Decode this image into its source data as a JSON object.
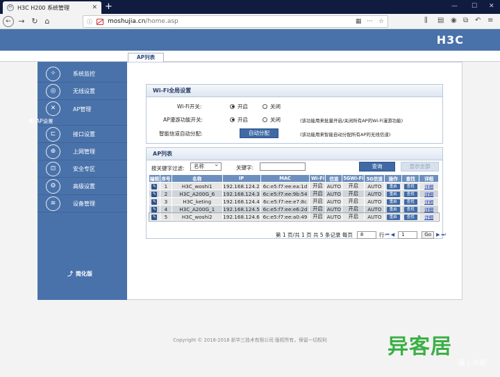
{
  "browser": {
    "tab_title": "H3C H200 系统管理",
    "tab_favicon": "Ⓜ",
    "url_host": "moshujia.cn",
    "url_path": "/home.asp"
  },
  "header": {
    "logo": "H3C"
  },
  "top_tab": "AP列表",
  "sidebar": {
    "items": [
      {
        "label": "系统监控",
        "icon": "monitor-icon",
        "glyph": "✧"
      },
      {
        "label": "无线设置",
        "icon": "wireless-icon",
        "glyph": "◎"
      },
      {
        "label": "AP管理",
        "icon": "ap-icon",
        "glyph": "✕"
      },
      {
        "label": "接口设置",
        "icon": "interface-icon",
        "glyph": "⊏"
      },
      {
        "label": "上网管理",
        "icon": "globe-icon",
        "glyph": "⊕"
      },
      {
        "label": "安全专区",
        "icon": "lock-icon",
        "glyph": "⊡"
      },
      {
        "label": "高级设置",
        "icon": "gear-icon",
        "glyph": "⚙"
      },
      {
        "label": "设备管理",
        "icon": "device-icon",
        "glyph": "≋"
      }
    ],
    "sub_item": "AP设置",
    "simplify": "简化版"
  },
  "wifi_global": {
    "title": "Wi-Fi全局设置",
    "wifi_switch_label": "Wi-Fi开关:",
    "on": "开启",
    "off": "关闭",
    "roaming_label": "AP漫游功能开关:",
    "roaming_hint": "(该功能用来批量开启/关闭所有AP的Wi-Fi漫游功能)",
    "channel_label": "智能信道自动分配:",
    "auto_assign_button": "自动分配",
    "channel_hint": "(该功能用来智能自动分配所有AP的无线信道)"
  },
  "ap_list": {
    "title": "AP列表",
    "filter_label": "按关键字过滤:",
    "filter_selected": "名称",
    "keyword_label": "关键字:",
    "keyword_value": "",
    "query_button": "查询",
    "show_all_button": "显示全部",
    "columns": [
      "编辑",
      "序号",
      "名称",
      "IP",
      "MAC",
      "Wi-Fi",
      "信道",
      "5GWi-Fi",
      "5G信道",
      "操作",
      "查找",
      "详细"
    ],
    "rows": [
      {
        "no": "1",
        "name": "H3C_woshi1",
        "ip": "192.168.124.2",
        "mac": "6c:e5:f7:ee:ea:1d",
        "wifi": "开启",
        "channel": "AUTO",
        "wifi5g": "开启",
        "channel5g": "AUTO",
        "op": "重启",
        "find": "查找",
        "detail": "详细"
      },
      {
        "no": "2",
        "name": "H3C_A200G_6",
        "ip": "192.168.124.3",
        "mac": "6c:e5:f7:ee:9b:54",
        "wifi": "开启",
        "channel": "AUTO",
        "wifi5g": "开启",
        "channel5g": "AUTO",
        "op": "重启",
        "find": "查找",
        "detail": "详细"
      },
      {
        "no": "3",
        "name": "H3C_keting",
        "ip": "192.168.124.4",
        "mac": "6c:e5:f7:ee:e7:8c",
        "wifi": "开启",
        "channel": "AUTO",
        "wifi5g": "开启",
        "channel5g": "AUTO",
        "op": "重启",
        "find": "查找",
        "detail": "详细"
      },
      {
        "no": "4",
        "name": "H3C_A200G_1",
        "ip": "192.168.124.5",
        "mac": "6c:e5:f7:ee:e6:2d",
        "wifi": "开启",
        "channel": "AUTO",
        "wifi5g": "开启",
        "channel5g": "AUTO",
        "op": "重启",
        "find": "查找",
        "detail": "详细"
      },
      {
        "no": "5",
        "name": "H3C_woshi2",
        "ip": "192.168.124.6",
        "mac": "6c:e5:f7:ee:a0:49",
        "wifi": "开启",
        "channel": "AUTO",
        "wifi5g": "开启",
        "channel5g": "AUTO",
        "op": "重启",
        "find": "查找",
        "detail": "详细"
      }
    ],
    "pager": {
      "summary": "第 1 页/共 1 页 共 5 条记录 每页",
      "per_page": "8",
      "unit": "行",
      "page_input": "1",
      "go": "Go"
    }
  },
  "footer": {
    "copyright": "Copyright © 2018-2018 新华三技术有限公司 版权所有，保留一切权利"
  },
  "watermark": {
    "text": "异客居",
    "sub": "装 | 众观"
  },
  "colors": {
    "brand_blue": "#4a72aa",
    "table_header": "#6c8fbe",
    "watermark_green": "#3bb045"
  }
}
